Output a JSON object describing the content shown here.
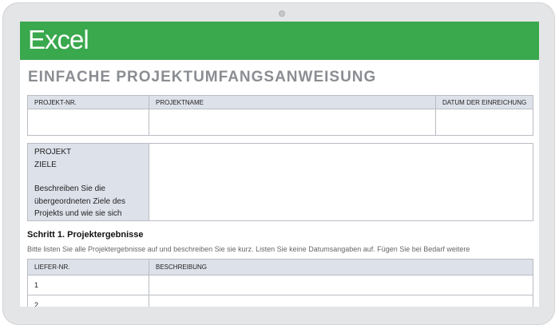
{
  "app": {
    "name": "Excel"
  },
  "document": {
    "title": "EINFACHE PROJEKTUMFANGSANWEISUNG"
  },
  "header_table": {
    "columns": [
      "PROJEKT-NR.",
      "PROJEKTNAME",
      "DATUM DER EINREICHUNG"
    ],
    "values": [
      "",
      "",
      ""
    ]
  },
  "goals": {
    "label_line1": "PROJEKT",
    "label_line2": "ZIELE",
    "instruction_line1": "Beschreiben Sie die",
    "instruction_line2": "übergeordneten Ziele des",
    "instruction_line3": "Projekts und wie sie sich",
    "content": ""
  },
  "step1": {
    "title": "Schritt 1. Projektergebnisse",
    "description": "Bitte listen Sie alle Projektergebnisse auf und beschreiben Sie sie kurz. Listen Sie keine Datumsangaben auf. Fügen Sie bei Bedarf weitere",
    "columns": [
      "LIEFER-NR.",
      "BESCHREIBUNG"
    ],
    "rows": [
      {
        "nr": "1",
        "beschreibung": ""
      },
      {
        "nr": "2",
        "beschreibung": ""
      }
    ]
  }
}
